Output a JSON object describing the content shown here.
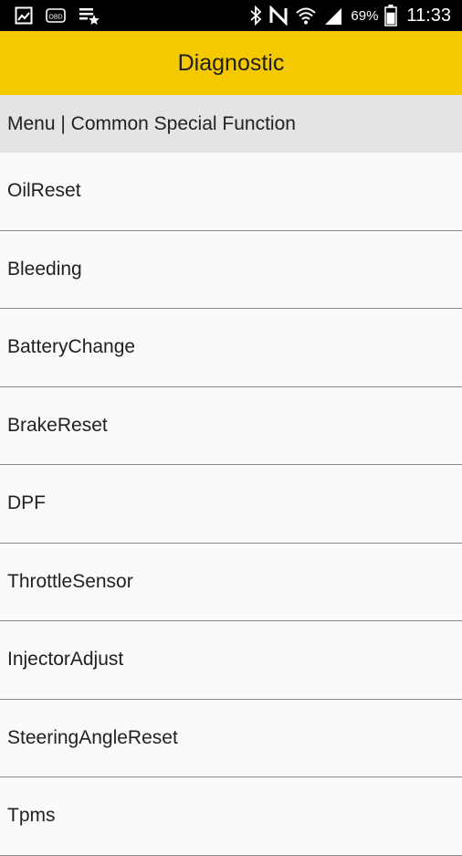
{
  "status_bar": {
    "icons_left": [
      "image-icon",
      "obd-icon",
      "checklist-star-icon"
    ],
    "icons_right": [
      "bluetooth-icon",
      "nfc-icon",
      "wifi-icon",
      "signal-icon",
      "battery-icon"
    ],
    "obd_label": "OBD",
    "battery_percent": "69%",
    "battery_level": 0.69,
    "time": "11:33"
  },
  "app_bar": {
    "title": "Diagnostic",
    "background": "#f4c900"
  },
  "breadcrumb": {
    "text": "Menu | Common Special Function"
  },
  "menu": {
    "items": [
      {
        "label": "OilReset"
      },
      {
        "label": "Bleeding"
      },
      {
        "label": "BatteryChange"
      },
      {
        "label": "BrakeReset"
      },
      {
        "label": "DPF"
      },
      {
        "label": "ThrottleSensor"
      },
      {
        "label": "InjectorAdjust"
      },
      {
        "label": "SteeringAngleReset"
      },
      {
        "label": "Tpms"
      }
    ]
  }
}
